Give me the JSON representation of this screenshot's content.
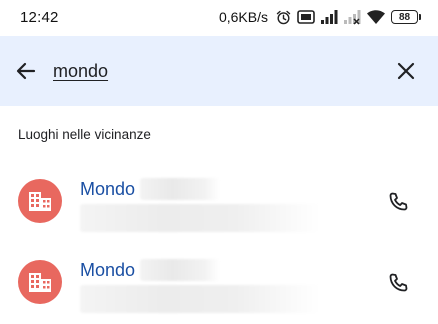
{
  "status_bar": {
    "time": "12:42",
    "speed": "0,6KB/s",
    "battery": "88",
    "icons": [
      "alarm-icon",
      "volte-icon",
      "signal-icon",
      "no-signal-icon",
      "wifi-icon",
      "battery-icon"
    ]
  },
  "search": {
    "query": "mondo",
    "back_icon": "arrow-left-icon",
    "clear_icon": "close-icon"
  },
  "section": {
    "title": "Luoghi nelle vicinanze"
  },
  "results": [
    {
      "title": "Mondo",
      "icon": "building-icon",
      "action_icon": "phone-icon"
    },
    {
      "title": "Mondo",
      "icon": "building-icon",
      "action_icon": "phone-icon"
    }
  ],
  "colors": {
    "search_bg": "#e8f0fe",
    "avatar_bg": "#e8685f",
    "title_blue": "#1a4fa3"
  }
}
